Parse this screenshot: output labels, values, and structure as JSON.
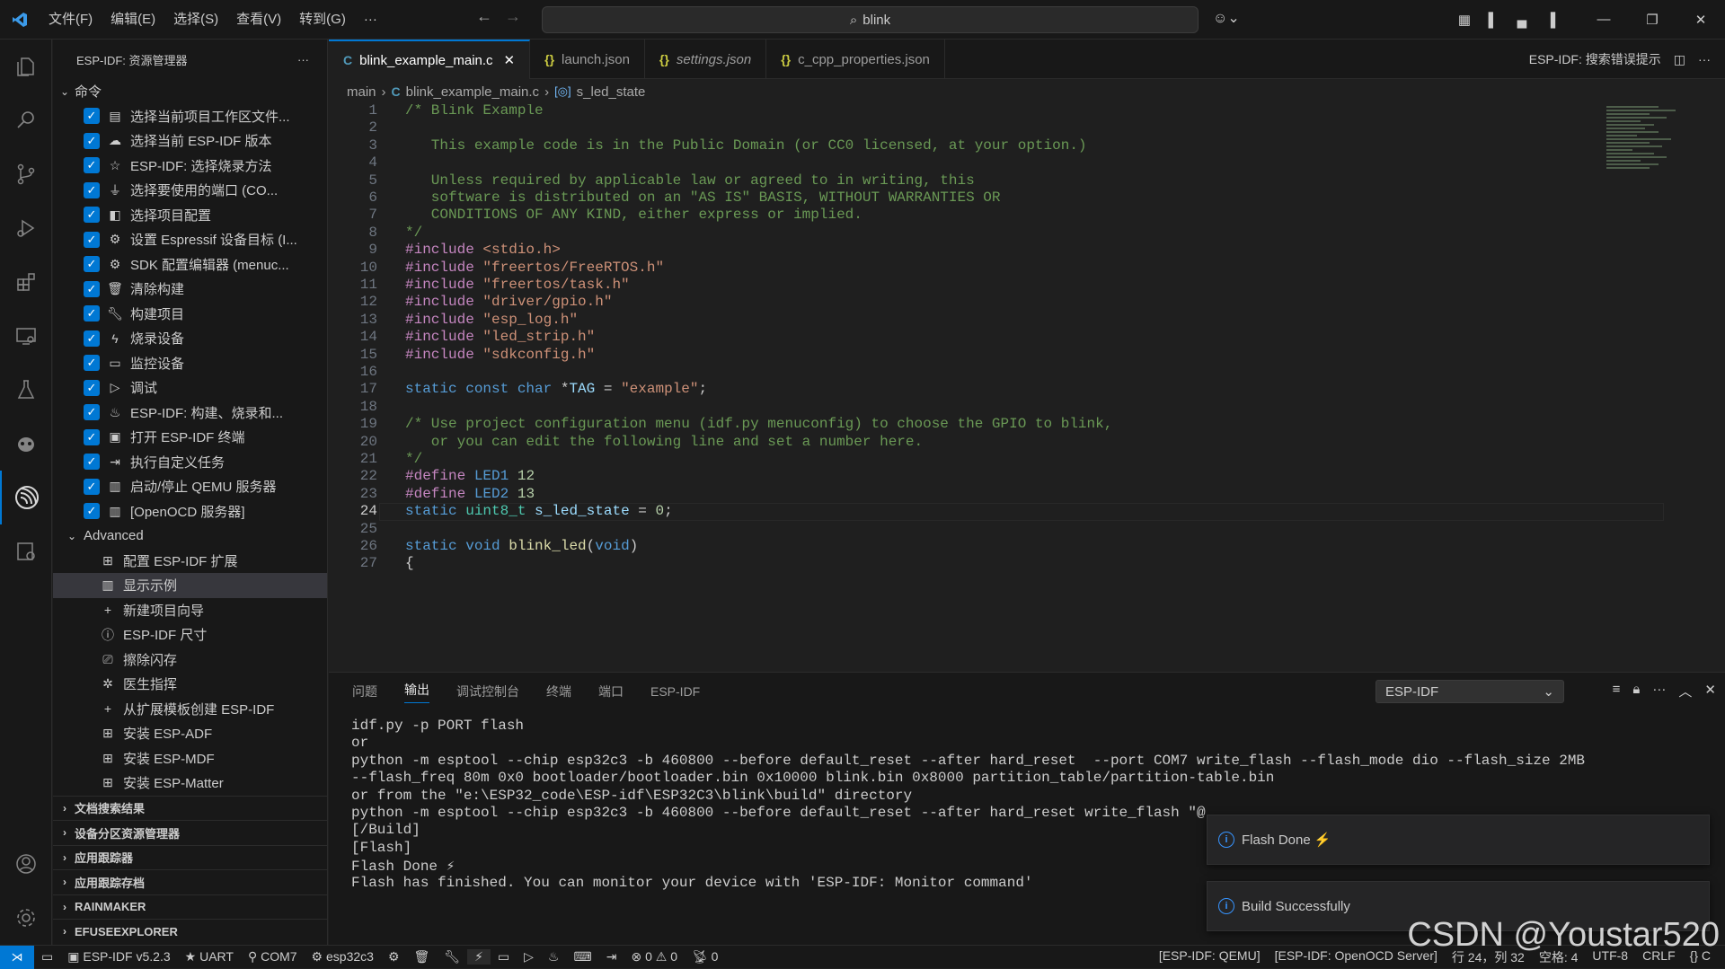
{
  "titlebar": {
    "menus": [
      "文件(F)",
      "编辑(E)",
      "选择(S)",
      "查看(V)",
      "转到(G)",
      "···"
    ],
    "search": "blink"
  },
  "sidebar": {
    "title": "ESP-IDF: 资源管理器",
    "commands_label": "命令",
    "commands": [
      {
        "icon": "folder-icon",
        "label": "选择当前项目工作区文件..."
      },
      {
        "icon": "esp-version-icon",
        "label": "选择当前 ESP-IDF 版本"
      },
      {
        "icon": "star-icon",
        "label": "ESP-IDF: 选择烧录方法"
      },
      {
        "icon": "plug-icon",
        "label": "选择要使用的端口 (CO..."
      },
      {
        "icon": "config-icon",
        "label": "选择项目配置"
      },
      {
        "icon": "chip-icon",
        "label": "设置 Espressif 设备目标 (I..."
      },
      {
        "icon": "gear-icon",
        "label": "SDK 配置编辑器 (menuc..."
      },
      {
        "icon": "trash-icon",
        "label": "清除构建"
      },
      {
        "icon": "wrench-icon",
        "label": "构建项目"
      },
      {
        "icon": "flash-icon",
        "label": "烧录设备"
      },
      {
        "icon": "monitor-icon",
        "label": "监控设备"
      },
      {
        "icon": "debug-icon",
        "label": "调试"
      },
      {
        "icon": "flame-icon",
        "label": "ESP-IDF: 构建、烧录和..."
      },
      {
        "icon": "terminal-icon",
        "label": "打开 ESP-IDF 终端"
      },
      {
        "icon": "run-icon",
        "label": "执行自定义任务"
      },
      {
        "icon": "server-icon",
        "label": "启动/停止 QEMU 服务器"
      },
      {
        "icon": "server-icon",
        "label": "[OpenOCD 服务器]"
      }
    ],
    "advanced_label": "Advanced",
    "advanced": [
      {
        "icon": "extensions-icon",
        "label": "配置 ESP-IDF 扩展"
      },
      {
        "icon": "book-icon",
        "label": "显示示例"
      },
      {
        "icon": "plus-icon",
        "label": "新建项目向导"
      },
      {
        "icon": "info-icon",
        "label": "ESP-IDF 尺寸"
      },
      {
        "icon": "erase-icon",
        "label": "擦除闪存"
      },
      {
        "icon": "doctor-icon",
        "label": "医生指挥"
      },
      {
        "icon": "plus-icon",
        "label": "从扩展模板创建 ESP-IDF"
      },
      {
        "icon": "extensions-icon",
        "label": "安装 ESP-ADF"
      },
      {
        "icon": "extensions-icon",
        "label": "安装 ESP-MDF"
      },
      {
        "icon": "extensions-icon",
        "label": "安装 ESP-Matter"
      }
    ],
    "sections": [
      "文档搜索结果",
      "设备分区资源管理器",
      "应用跟踪器",
      "应用跟踪存档",
      "RAINMAKER",
      "EFUSEEXPLORER"
    ]
  },
  "tabs": [
    {
      "icon": "C",
      "label": "blink_example_main.c",
      "active": true
    },
    {
      "icon": "{}",
      "label": "launch.json"
    },
    {
      "icon": "{}",
      "label": "settings.json"
    },
    {
      "icon": "{}",
      "label": "c_cpp_properties.json"
    }
  ],
  "editor_actions": {
    "label": "ESP-IDF: 搜索错误提示"
  },
  "breadcrumb": {
    "folder": "main",
    "file": "blink_example_main.c",
    "symbol": "s_led_state"
  },
  "code": {
    "current_line": 24,
    "lines": [
      "/* Blink Example",
      "",
      "   This example code is in the Public Domain (or CC0 licensed, at your option.)",
      "",
      "   Unless required by applicable law or agreed to in writing, this",
      "   software is distributed on an \"AS IS\" BASIS, WITHOUT WARRANTIES OR",
      "   CONDITIONS OF ANY KIND, either express or implied.",
      "*/",
      "#include <stdio.h>",
      "#include \"freertos/FreeRTOS.h\"",
      "#include \"freertos/task.h\"",
      "#include \"driver/gpio.h\"",
      "#include \"esp_log.h\"",
      "#include \"led_strip.h\"",
      "#include \"sdkconfig.h\"",
      "",
      "static const char *TAG = \"example\";",
      "",
      "/* Use project configuration menu (idf.py menuconfig) to choose the GPIO to blink,",
      "   or you can edit the following line and set a number here.",
      "*/",
      "#define LED1 12",
      "#define LED2 13",
      "static uint8_t s_led_state = 0;",
      "",
      "static void blink_led(void)",
      "{"
    ]
  },
  "panel": {
    "tabs": [
      "问题",
      "输出",
      "调试控制台",
      "终端",
      "端口",
      "ESP-IDF"
    ],
    "active_tab": 1,
    "output_channel": "ESP-IDF",
    "output_lines": [
      "idf.py -p PORT flash",
      "or",
      "python -m esptool --chip esp32c3 -b 460800 --before default_reset --after hard_reset  --port COM7 write_flash --flash_mode dio --flash_size 2MB",
      "--flash_freq 80m 0x0 bootloader/bootloader.bin 0x10000 blink.bin 0x8000 partition_table/partition-table.bin",
      "or from the \"e:\\ESP32_code\\ESP-idf\\ESP32C3\\blink\\build\" directory",
      "python -m esptool --chip esp32c3 -b 460800 --before default_reset --after hard_reset write_flash \"@",
      "[/Build]",
      "[Flash]",
      "Flash Done ⚡",
      "Flash has finished. You can monitor your device with 'ESP-IDF: Monitor command'"
    ]
  },
  "notifications": [
    {
      "text": "Flash Done ⚡"
    },
    {
      "text": "Build Successfully"
    }
  ],
  "statusbar": {
    "idf_version": "ESP-IDF v5.2.3",
    "flash_method": "UART",
    "port": "COM7",
    "target": "esp32c3",
    "errors": "0",
    "warnings": "0",
    "ports": "0",
    "qemu": "[ESP-IDF: QEMU]",
    "openocd": "[ESP-IDF: OpenOCD Server]",
    "position": "行 24，列 32",
    "spaces": "空格: 4",
    "encoding": "UTF-8",
    "eol": "CRLF",
    "language": "{} C"
  },
  "watermark": "CSDN @Youstar520",
  "colors": {
    "accent": "#0078d4",
    "background": "#1f1f1f",
    "sidebar": "#181818"
  }
}
